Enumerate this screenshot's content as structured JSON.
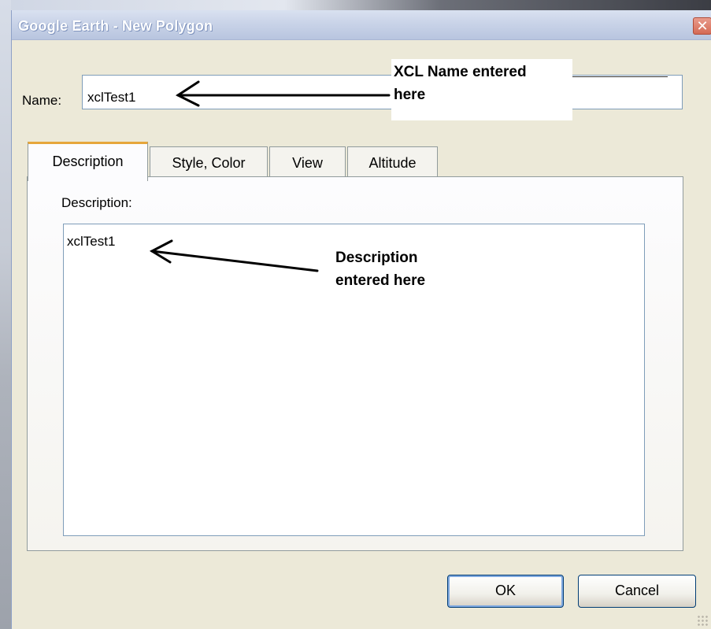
{
  "window": {
    "title": "Google Earth - New Polygon",
    "close_glyph": "✕"
  },
  "name": {
    "label": "Name:",
    "value": "xclTest1"
  },
  "tabs": [
    {
      "label": "Description",
      "active": true
    },
    {
      "label": "Style, Color",
      "active": false
    },
    {
      "label": "View",
      "active": false
    },
    {
      "label": "Altitude",
      "active": false
    }
  ],
  "description": {
    "label": "Description:",
    "value": "xclTest1"
  },
  "annotations": {
    "name_callout_line1": "XCL Name entered",
    "name_callout_line2": "here",
    "desc_callout_line1": "Description",
    "desc_callout_line2": "entered here"
  },
  "buttons": {
    "ok": "OK",
    "cancel": "Cancel"
  },
  "colors": {
    "active_tab_accent": "#e6a63b",
    "dialog_bg": "#ece9d8",
    "input_border": "#7f9db9"
  }
}
